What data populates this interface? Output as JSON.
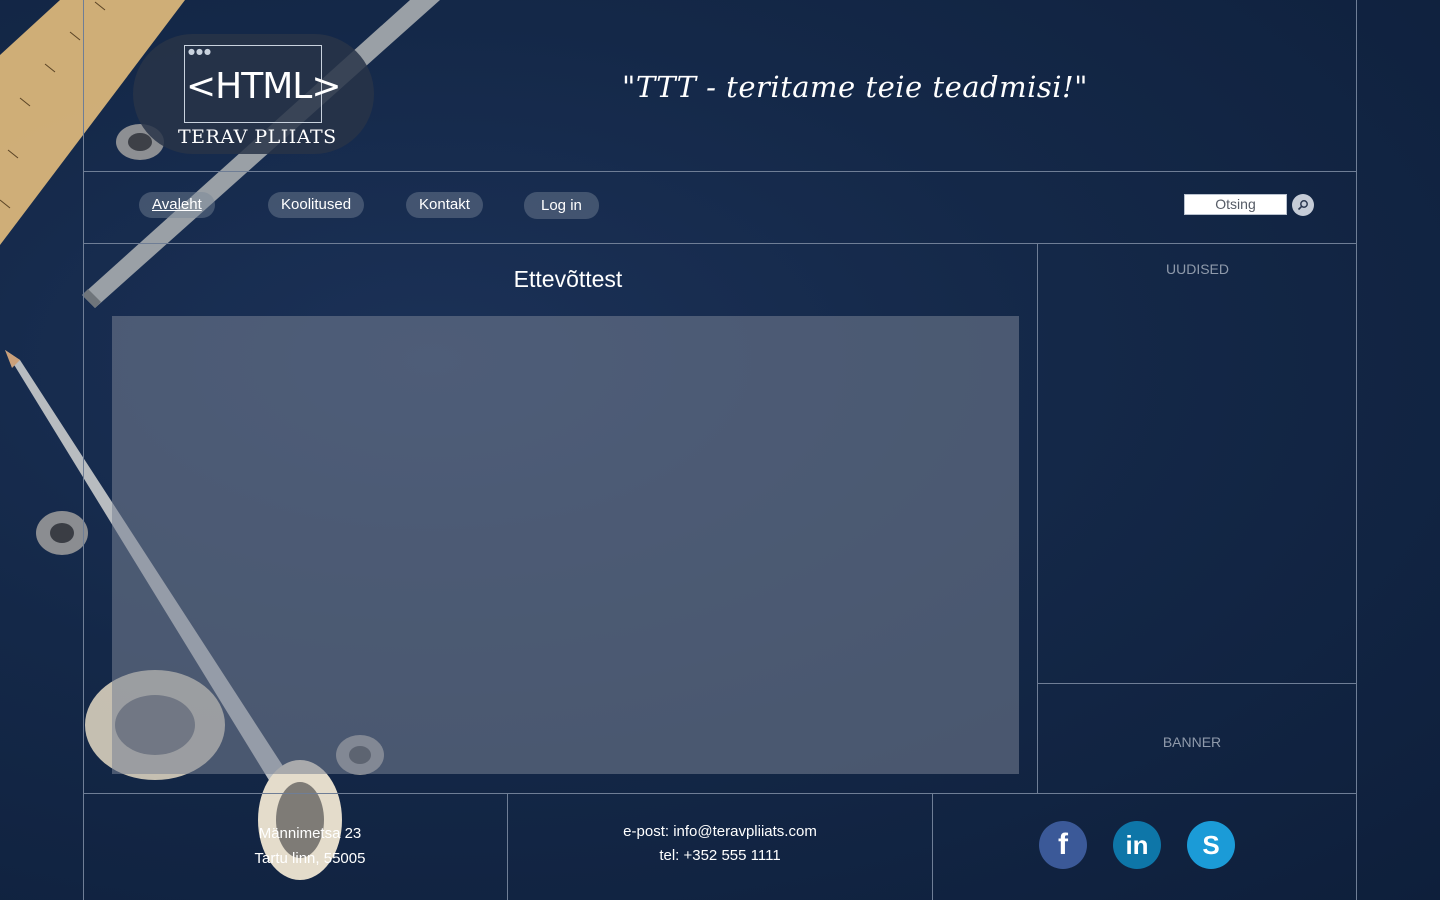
{
  "header": {
    "logo_text": "<HTML>",
    "logo_name": "TERAV PLIIATS",
    "slogan": "\"TTT - teritame teie teadmisi!\""
  },
  "nav": {
    "items": [
      {
        "label": "Avaleht",
        "active": true
      },
      {
        "label": "Koolitused",
        "active": false
      },
      {
        "label": "Kontakt",
        "active": false
      },
      {
        "label": "Log in",
        "active": false
      }
    ],
    "search": {
      "placeholder": "Otsing",
      "button_icon": "search-icon"
    }
  },
  "main": {
    "title": "Ettevõttest"
  },
  "aside": {
    "news_label": "UUDISED",
    "banner_label": "BANNER"
  },
  "footer": {
    "address_line1": "Männimetsa 23",
    "address_line2": "Tartu linn, 55005",
    "email": "e-post: info@teravpliiats.com",
    "phone": "tel: +352 555 1111",
    "social": [
      {
        "icon": "facebook-icon",
        "glyph": "f",
        "color": "#3b5998"
      },
      {
        "icon": "linkedin-icon",
        "glyph": "in",
        "color": "#0e76a8"
      },
      {
        "icon": "skype-icon",
        "glyph": "S",
        "color": "#1b9bd7"
      }
    ]
  },
  "colors": {
    "background": "#142848",
    "lines": "#6f7e96",
    "panel": "#78829a"
  }
}
